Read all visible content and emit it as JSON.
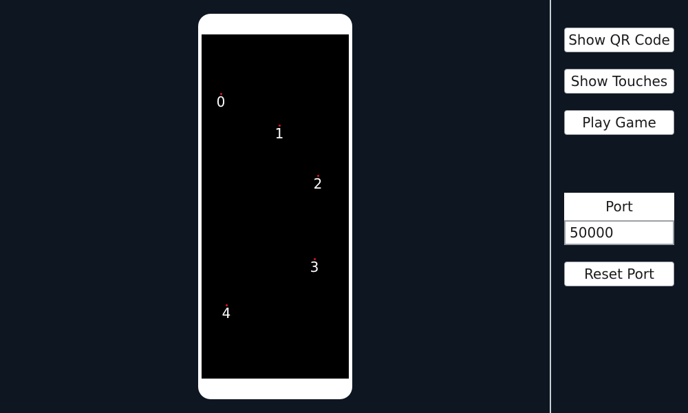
{
  "colors": {
    "background": "#0e1621",
    "phone_frame": "#ffffff",
    "screen": "#000000",
    "touch_dot": "#e01020"
  },
  "touches": [
    {
      "label": "0"
    },
    {
      "label": "1"
    },
    {
      "label": "2"
    },
    {
      "label": "3"
    },
    {
      "label": "4"
    }
  ],
  "panel": {
    "show_qr_label": "Show QR Code",
    "show_touches_label": "Show Touches",
    "play_game_label": "Play Game",
    "port_label": "Port",
    "port_value": "50000",
    "reset_port_label": "Reset Port"
  }
}
